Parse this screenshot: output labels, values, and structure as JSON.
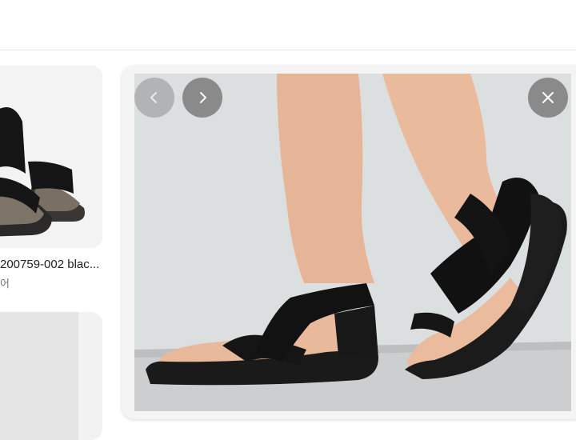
{
  "left_result": {
    "title": "200759-002 blac...",
    "source": "어"
  },
  "viewer": {
    "prev_icon": "chevron-left-icon",
    "next_icon": "chevron-right-icon",
    "close_icon": "close-icon"
  },
  "colors": {
    "sandal": "#141414",
    "skin": "#e8b99a",
    "backdrop": "#d8dbdd",
    "floor": "#c9cacb"
  }
}
